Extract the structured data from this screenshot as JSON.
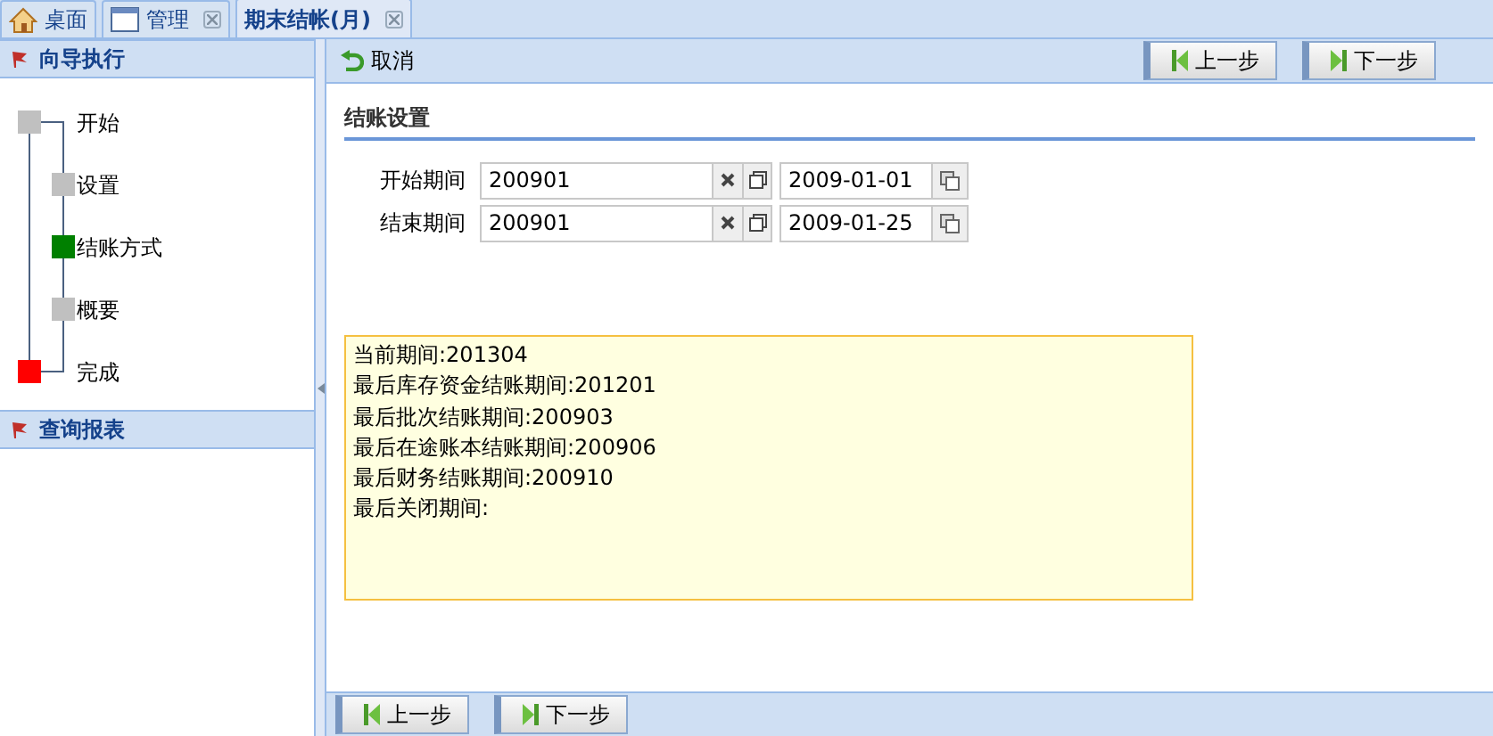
{
  "tabs": [
    {
      "label": "桌面",
      "kind": "home",
      "selected": false,
      "closable": false
    },
    {
      "label": "管理",
      "kind": "window",
      "selected": false,
      "closable": true
    },
    {
      "label": "期末结帐(月)",
      "kind": "plain",
      "selected": true,
      "closable": true
    }
  ],
  "sidebar": {
    "panels": [
      {
        "title": "向导执行",
        "steps": [
          {
            "label": "开始",
            "color": "#c0c0c0",
            "children": [
              {
                "label": "设置",
                "color": "#c0c0c0"
              },
              {
                "label": "结账方式",
                "color": "#008000"
              },
              {
                "label": "概要",
                "color": "#c0c0c0"
              }
            ]
          },
          {
            "label": "完成",
            "color": "#ff0000"
          }
        ]
      },
      {
        "title": "查询报表"
      }
    ]
  },
  "toolbar": {
    "cancel": "取消",
    "buttons": [
      {
        "label": "上一步",
        "kind": "prev"
      },
      {
        "label": "下一步",
        "kind": "next"
      }
    ]
  },
  "section": {
    "title": "结账设置",
    "rows": [
      {
        "label": "开始期间",
        "period": "200901",
        "date": "2009-01-01"
      },
      {
        "label": "结束期间",
        "period": "200901",
        "date": "2009-01-25"
      }
    ]
  },
  "info_lines": [
    "当前期间:201304",
    "最后库存资金结账期间:201201",
    "最后批次结账期间:200903",
    "最后在途账本结账期间:200906",
    "最后财务结账期间:200910",
    "最后关闭期间:"
  ],
  "footer": {
    "buttons": [
      {
        "label": "上一步",
        "kind": "prev"
      },
      {
        "label": "下一步",
        "kind": "next"
      }
    ]
  }
}
